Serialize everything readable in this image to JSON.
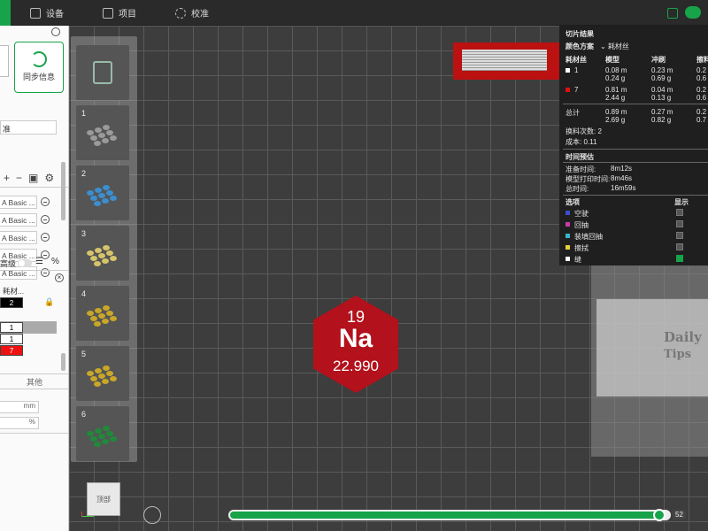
{
  "topbar": {
    "tabs": [
      {
        "label": "设备",
        "icon": "device-icon"
      },
      {
        "label": "项目",
        "icon": "project-icon"
      },
      {
        "label": "校准",
        "icon": "calibrate-icon"
      }
    ]
  },
  "sidebar": {
    "sync_label": "同步信息",
    "preset_value": "准",
    "filaments": [
      "A Basic ...",
      "A Basic ...",
      "A Basic ...",
      "A Basic ...",
      "A Basic ..."
    ],
    "advanced_label": "高级",
    "table_header": "耗材...",
    "cells": [
      "2",
      "1",
      "1",
      "7"
    ],
    "other_label": "其他",
    "unit_mm": "mm",
    "unit_pct": "%"
  },
  "plates": {
    "items": [
      {
        "num": "1",
        "color": "#9a9a9a"
      },
      {
        "num": "2",
        "color": "#3b8fd0"
      },
      {
        "num": "3",
        "color": "#d6c46a"
      },
      {
        "num": "4",
        "color": "#c9a728"
      },
      {
        "num": "5",
        "color": "#c9a728"
      },
      {
        "num": "6",
        "color": "#1f8a3a"
      }
    ]
  },
  "element": {
    "number": "19",
    "symbol": "Na",
    "mass": "22.990",
    "color": "#b3111c"
  },
  "results": {
    "title": "切片结果",
    "color_scheme_label": "颜色方案",
    "color_scheme_value": "耗材丝",
    "col_filament": "耗材丝",
    "col_model": "模型",
    "col_purge": "冲刷",
    "col_tower": "擦料",
    "rows": [
      {
        "id": "1",
        "swatch": "#ffffff",
        "model": [
          "0.08 m",
          "0.24 g"
        ],
        "purge": [
          "0.23 m",
          "0.69 g"
        ],
        "tower": [
          "0.2",
          "0.6"
        ]
      },
      {
        "id": "7",
        "swatch": "#dd1111",
        "model": [
          "0.81 m",
          "2.44 g"
        ],
        "purge": [
          "0.04 m",
          "0.13 g"
        ],
        "tower": [
          "0.2",
          "0.6"
        ]
      }
    ],
    "total_label": "总计",
    "total": {
      "model": [
        "0.89 m",
        "2.69 g"
      ],
      "purge": [
        "0.27 m",
        "0.82 g"
      ],
      "tower": [
        "0.2",
        "0.7"
      ]
    },
    "changes_label": "换料次数:",
    "changes_value": "2",
    "cost_label": "成本:",
    "cost_value": "0.11",
    "time_title": "时间预估",
    "prep_label": "准备时间:",
    "prep_value": "8m12s",
    "print_label": "模型打印时间:",
    "print_value": "8m46s",
    "total_time_label": "总时间:",
    "total_time_value": "16m59s",
    "options_label": "选项",
    "show_label": "显示",
    "options": [
      {
        "label": "空驶",
        "color": "#3a4fc9",
        "checked": false
      },
      {
        "label": "回抽",
        "color": "#c93aa8",
        "checked": false
      },
      {
        "label": "装填回抽",
        "color": "#3ab4c9",
        "checked": false
      },
      {
        "label": "擦拭",
        "color": "#e6d23a",
        "checked": false
      },
      {
        "label": "缝",
        "color": "#ffffff",
        "checked": true
      }
    ]
  },
  "tips": {
    "title": "Daily",
    "subtitle": "Tips"
  },
  "bottom": {
    "view_label": "顶部",
    "layer": "52",
    "progress": 0.98
  }
}
